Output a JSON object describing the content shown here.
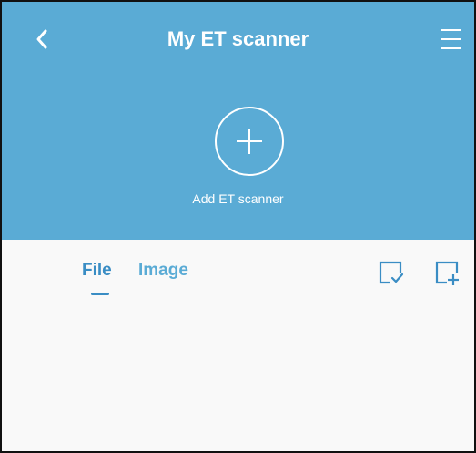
{
  "header": {
    "title": "My ET scanner",
    "back_icon": "chevron-left-icon",
    "menu_icon": "hamburger-menu-icon",
    "background_color": "#5aabd5"
  },
  "add_scanner": {
    "label": "Add ET scanner",
    "icon": "plus-circle-icon"
  },
  "tabs": [
    {
      "label": "File",
      "active": true
    },
    {
      "label": "Image",
      "active": false
    }
  ],
  "toolbar": {
    "select_icon": "select-check-icon",
    "add_icon": "add-square-icon"
  },
  "accent_color": "#5aabd5"
}
